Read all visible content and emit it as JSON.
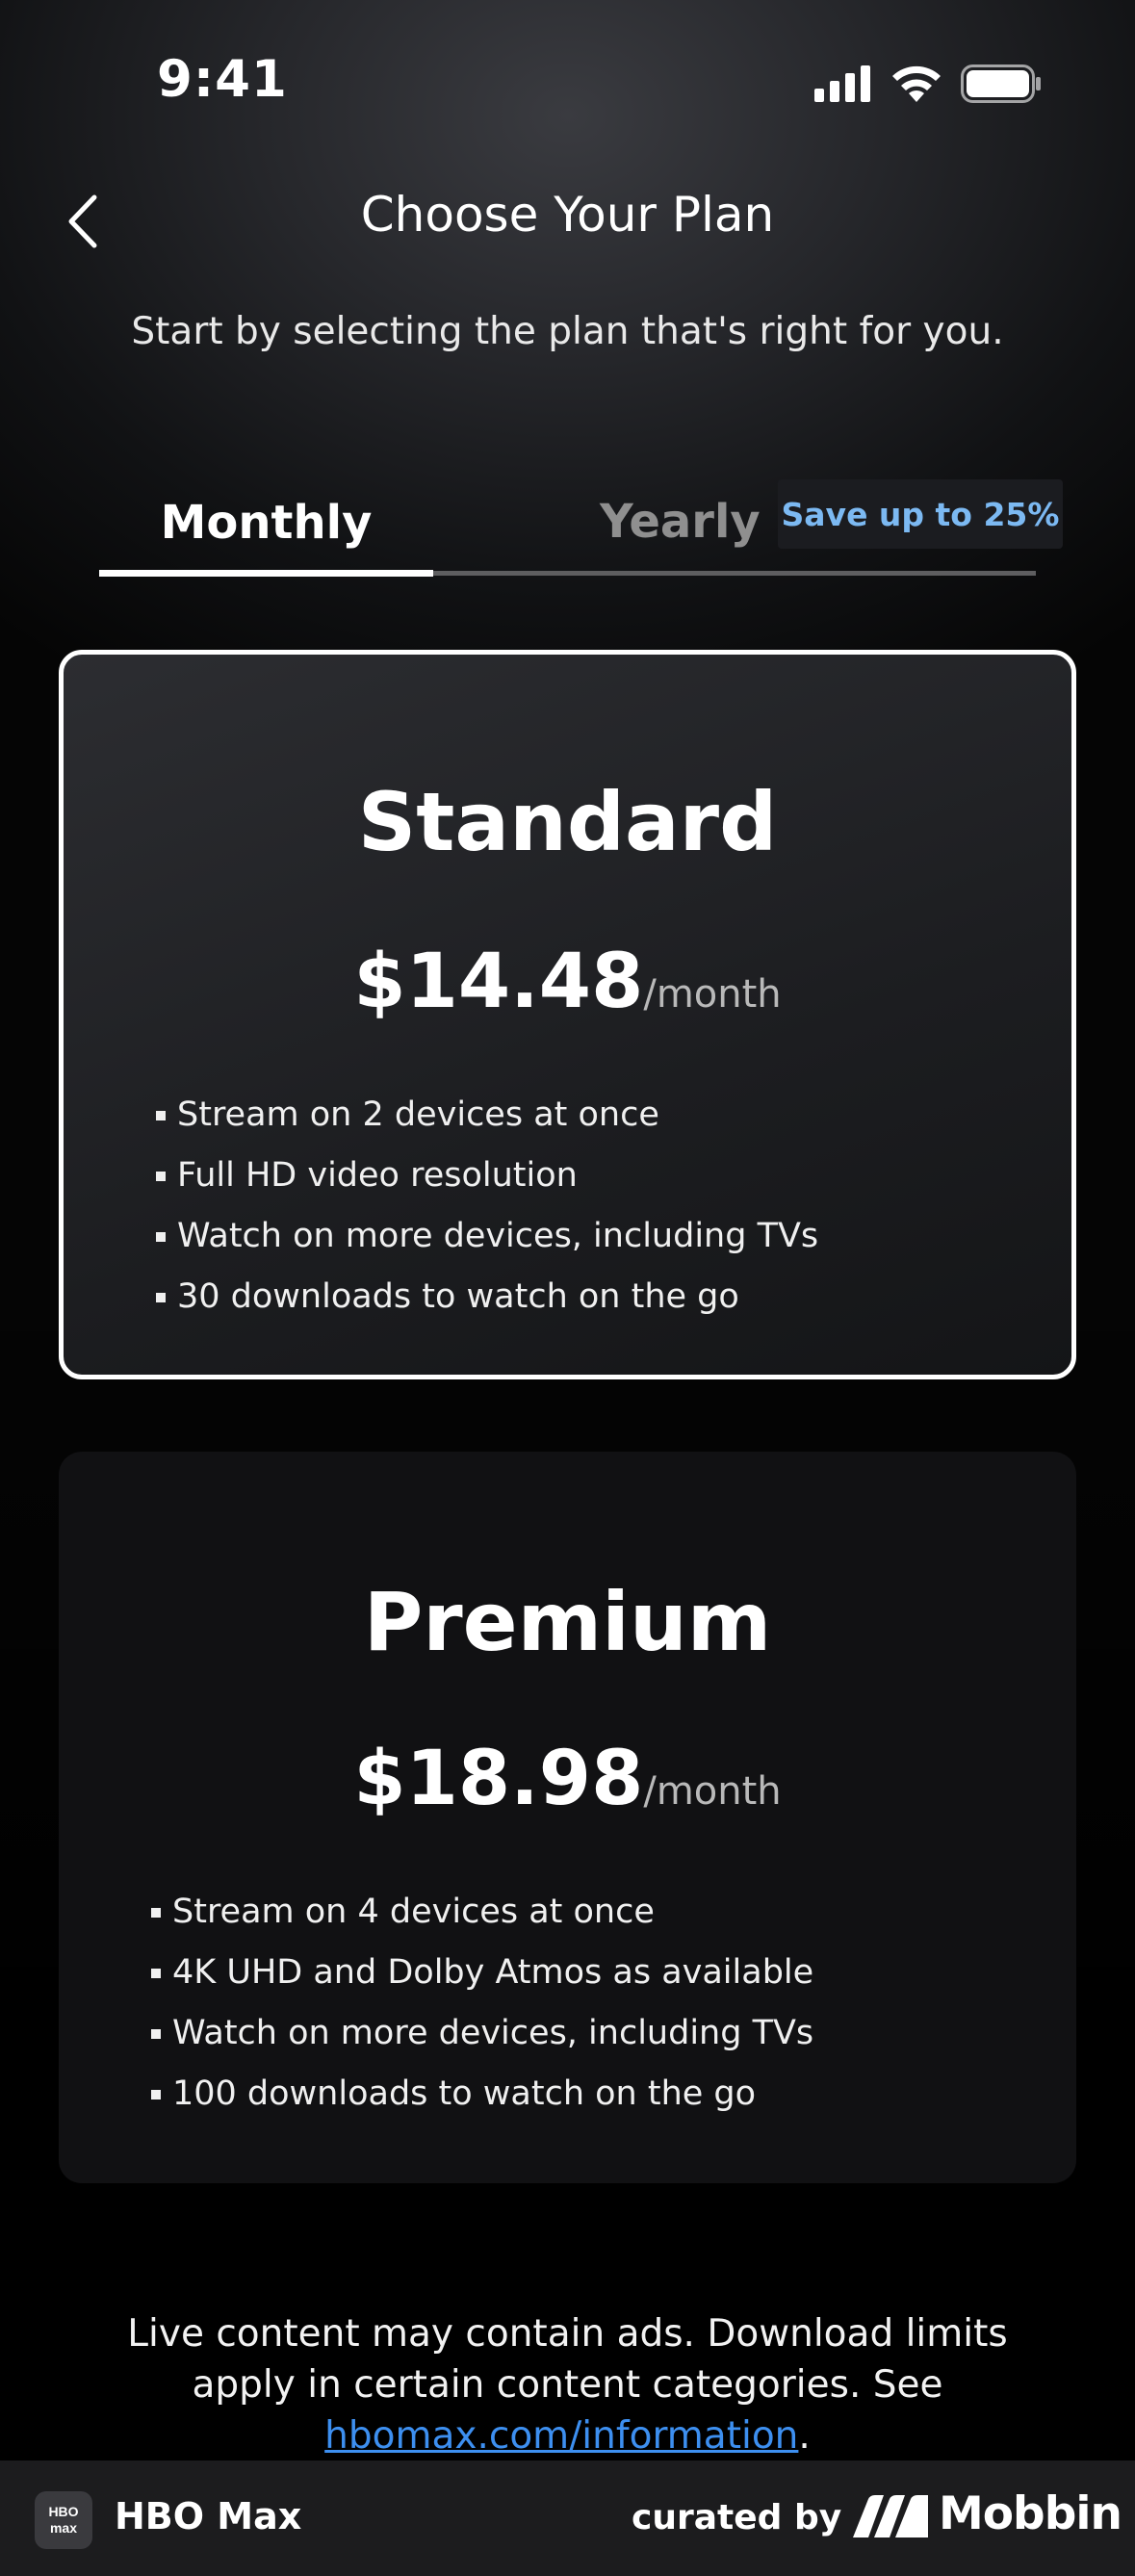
{
  "status_bar": {
    "time": "9:41"
  },
  "header": {
    "title": "Choose Your Plan",
    "subtitle": "Start by selecting the plan that's right for you."
  },
  "tabs": {
    "monthly_label": "Monthly",
    "yearly_label": "Yearly",
    "yearly_badge": "Save up to 25%",
    "selected": "Monthly"
  },
  "plans": [
    {
      "name": "Standard",
      "price": "$14.48",
      "period": "/month",
      "selected": true,
      "features": [
        "Stream on 2 devices at once",
        "Full HD video resolution",
        "Watch on more devices, including TVs",
        "30 downloads to watch on the go"
      ]
    },
    {
      "name": "Premium",
      "price": "$18.98",
      "period": "/month",
      "selected": false,
      "features": [
        "Stream on 4 devices at once",
        "4K UHD and Dolby Atmos as available",
        "Watch on more devices, including TVs",
        "100 downloads to watch on the go"
      ]
    }
  ],
  "disclaimer": {
    "text": "Live content may contain ads. Download limits apply in certain content categories. See ",
    "link": "hbomax.com/information",
    "suffix": "."
  },
  "footer": {
    "app_logo_text": "HBO max",
    "app_name": "HBO Max",
    "curated_by": "curated by",
    "brand": "Mobbin"
  },
  "colors": {
    "accent_badge_text": "#7cb9f2",
    "link": "#3d8ff0",
    "background": "#000000"
  }
}
